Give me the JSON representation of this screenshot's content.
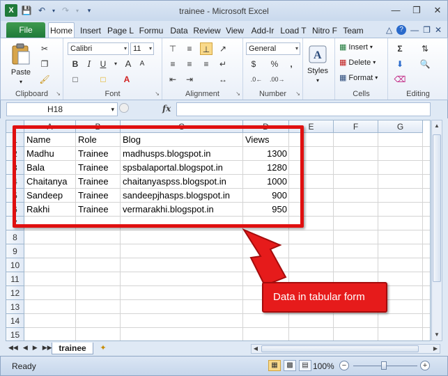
{
  "window": {
    "title": "trainee - Microsoft Excel"
  },
  "ribbon_tabs": [
    "File",
    "Home",
    "Insert",
    "Page L",
    "Formu",
    "Data",
    "Review",
    "View",
    "Add-Ir",
    "Load T",
    "Nitro F",
    "Team"
  ],
  "ribbon": {
    "clipboard": {
      "label": "Clipboard",
      "paste": "Paste"
    },
    "font": {
      "label": "Font",
      "family": "Calibri",
      "size": "11",
      "bold": "B",
      "italic": "I",
      "underline": "U",
      "grow": "A",
      "shrink": "A"
    },
    "alignment": {
      "label": "Alignment"
    },
    "number": {
      "label": "Number",
      "format": "General",
      "currency": "$",
      "percent": "%",
      "comma": ","
    },
    "styles": {
      "label": "Styles"
    },
    "cells": {
      "label": "Cells",
      "insert": "Insert",
      "delete": "Delete",
      "format": "Format"
    },
    "editing": {
      "label": "Editing"
    }
  },
  "formula_bar": {
    "name_box": "H18",
    "fx": "fx",
    "formula": ""
  },
  "columns": [
    "A",
    "B",
    "C",
    "D",
    "E",
    "F",
    "G"
  ],
  "rows": [
    "1",
    "2",
    "3",
    "4",
    "5",
    "6",
    "7",
    "8",
    "9",
    "10",
    "11",
    "12",
    "13",
    "14",
    "15"
  ],
  "table": {
    "headers": [
      "Name",
      "Role",
      "Blog",
      "Views"
    ],
    "rows": [
      [
        "Madhu",
        "Trainee",
        "madhusps.blogspot.in",
        "1300"
      ],
      [
        "Bala",
        "Trainee",
        "spsbalaportal.blogspot.in",
        "1280"
      ],
      [
        "Chaitanya",
        "Trainee",
        "chaitanyaspss.blogspot.in",
        "1000"
      ],
      [
        "Sandeep",
        "Trainee",
        "sandeepjhasps.blogspot.in",
        "900"
      ],
      [
        "Rakhi",
        "Trainee",
        "vermarakhi.blogspot.in",
        "950"
      ]
    ]
  },
  "sheet_tab": "trainee",
  "status": {
    "text": "Ready",
    "zoom": "100%"
  },
  "annotation": {
    "callout": "Data in tabular form",
    "color": "#e01010"
  }
}
